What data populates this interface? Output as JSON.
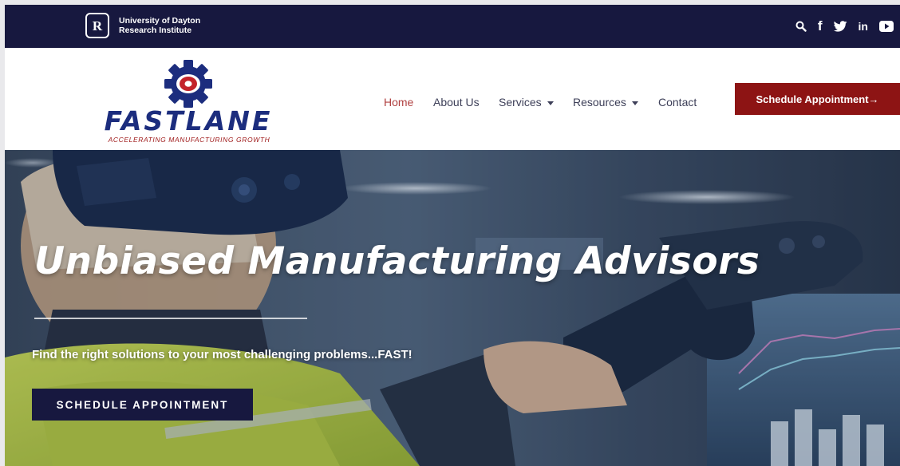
{
  "topbar": {
    "org_mark": "R",
    "org_name_line1": "University of Dayton",
    "org_name_line2": "Research Institute",
    "icons": [
      "search-icon",
      "facebook-icon",
      "twitter-icon",
      "linkedin-icon",
      "youtube-icon"
    ],
    "social_glyphs": {
      "facebook": "f",
      "linkedin": "in"
    }
  },
  "header": {
    "logo_wordmark": "FASTLANE",
    "logo_tagline": "ACCELERATING MANUFACTURING GROWTH",
    "nav": [
      {
        "label": "Home",
        "active": true
      },
      {
        "label": "About Us"
      },
      {
        "label": "Services",
        "dropdown": true
      },
      {
        "label": "Resources",
        "dropdown": true
      },
      {
        "label": "Contact"
      }
    ],
    "cta_label": "Schedule Appointment→"
  },
  "hero": {
    "title": "Unbiased Manufacturing Advisors",
    "subtitle": "Find the right solutions to your most challenging problems...FAST!",
    "cta_label": "SCHEDULE APPOINTMENT"
  },
  "colors": {
    "navy": "#17183f",
    "brand_blue": "#1c2d7e",
    "brand_red": "#8d1414",
    "nav_text": "#3d3f58",
    "nav_active": "#b04040"
  }
}
